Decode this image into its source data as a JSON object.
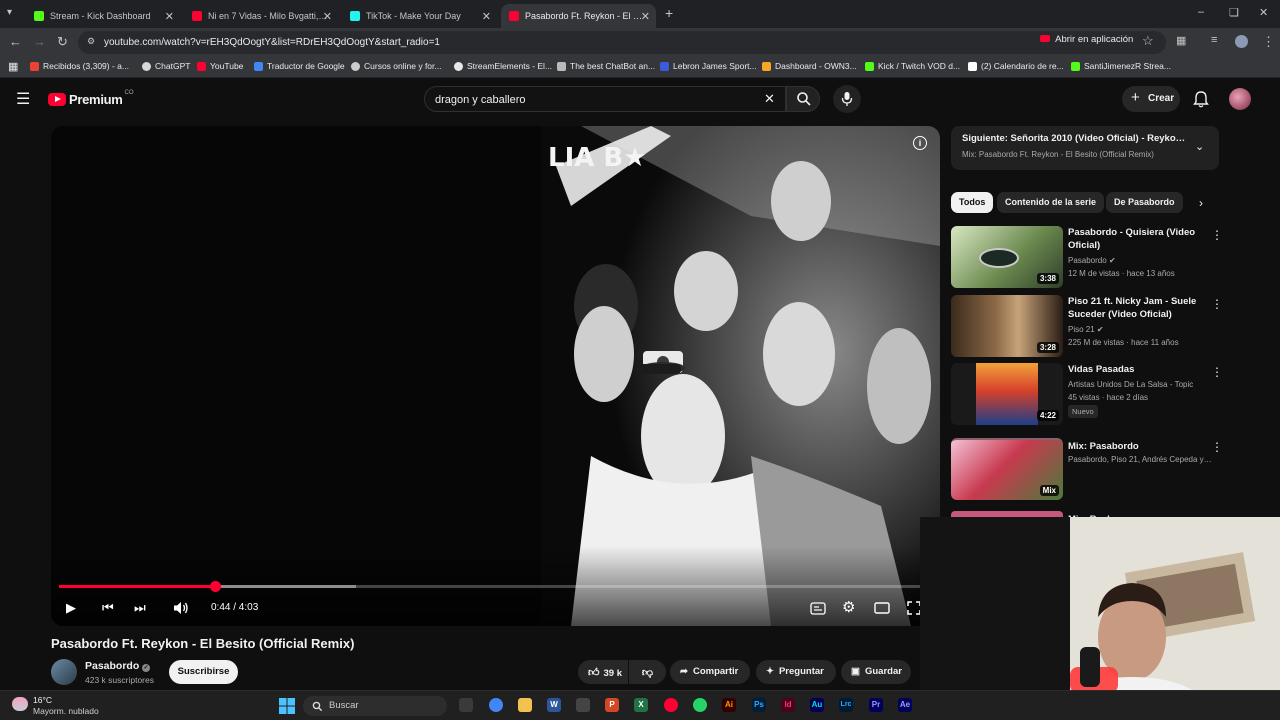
{
  "browser": {
    "tabs": [
      {
        "title": "Stream - Kick Dashboard",
        "color": "#53fc18"
      },
      {
        "title": "Ni en 7 Vidas - Milo Bvgatti, Al",
        "color": "#ff0033"
      },
      {
        "title": "TikTok - Make Your Day",
        "color": "#25f4ee"
      },
      {
        "title": "Pasabordo Ft. Reykon - El Besit",
        "color": "#ff0033"
      }
    ],
    "url": "youtube.com/watch?v=rEH3QdOogtY&list=RDrEH3QdOogtY&start_radio=1",
    "open_in_app": "Abrir en aplicación",
    "bookmarks": [
      {
        "label": "Recibidos (3,309) - a...",
        "color": "#ea4335"
      },
      {
        "label": "ChatGPT",
        "color": "#d9d9d9"
      },
      {
        "label": "YouTube",
        "color": "#ff0033"
      },
      {
        "label": "Traductor de Google",
        "color": "#4285f4"
      },
      {
        "label": "Cursos online y for...",
        "color": "#cccccc"
      },
      {
        "label": "StreamElements - El...",
        "color": "#e8e8e8"
      },
      {
        "label": "The best ChatBot an...",
        "color": "#bbbbbb"
      },
      {
        "label": "Lebron James Sport...",
        "color": "#3b5bdb"
      },
      {
        "label": "Dashboard - OWN3...",
        "color": "#f5a623"
      },
      {
        "label": "Kick / Twitch VOD d...",
        "color": "#53fc18"
      },
      {
        "label": "(2) Calendario de re...",
        "color": "#ffffff"
      },
      {
        "label": "SantiJimenezR Strea...",
        "color": "#53fc18"
      }
    ]
  },
  "youtube": {
    "logo": "Premium",
    "region": "CO",
    "search_value": "dragon y caballero",
    "create_label": "Crear",
    "accent": "#ff0033"
  },
  "player": {
    "time": "0:44 / 4:03",
    "progress_fraction": 0.181,
    "buffer_fraction": 0.344,
    "overlay_text": "LIA B★"
  },
  "video": {
    "title": "Pasabordo Ft. Reykon - El Besito (Official Remix)",
    "channel": "Pasabordo",
    "subscribers": "423 k suscriptores",
    "subscribe_label": "Suscribirse",
    "likes": "39 k",
    "share_label": "Compartir",
    "ask_label": "Preguntar",
    "save_label": "Guardar"
  },
  "sidebar": {
    "upnext_title": "Siguiente: Señorita 2010 (Video Oficial) - Reykon el ...",
    "upnext_sub": "Mix: Pasabordo Ft. Reykon - El Besito (Official Remix)",
    "chips": [
      "Todos",
      "Contenido de la serie",
      "De Pasabordo"
    ],
    "recommendations": [
      {
        "title": "Pasabordo - Quisiera (Video Oficial)",
        "channel": "Pasabordo",
        "meta": "12 M de vistas · hace 13 años",
        "duration": "3:38",
        "verified": true,
        "badge": ""
      },
      {
        "title": "Piso 21 ft. Nicky Jam - Suele Suceder (Video Oficial)",
        "channel": "Piso 21",
        "meta": "225 M de vistas · hace 11 años",
        "duration": "3:28",
        "verified": true,
        "badge": ""
      },
      {
        "title": "Vidas Pasadas",
        "channel": "Artistas Unidos De La Salsa - Topic",
        "meta": "45 vistas · hace 2 días",
        "duration": "4:22",
        "verified": false,
        "badge": "Nuevo"
      },
      {
        "title": "Mix: Pasabordo",
        "channel": "Pasabordo, Piso 21, Andrés Cepeda y m...",
        "meta": "",
        "duration": "Mix",
        "verified": false,
        "badge": ""
      }
    ],
    "partial_title": "Mix: Reykon"
  },
  "taskbar": {
    "temperature": "16°C",
    "weather": "Mayorm. nublado",
    "search_placeholder": "Buscar",
    "apps": [
      {
        "label": "",
        "color": "#3a3a3a"
      },
      {
        "label": "",
        "color": "#4285f4"
      },
      {
        "label": "",
        "color": "#f2c14e"
      },
      {
        "label": "W",
        "color": "#2b579a"
      },
      {
        "label": "",
        "color": "#444444"
      },
      {
        "label": "P",
        "color": "#d24726"
      },
      {
        "label": "X",
        "color": "#217346"
      },
      {
        "label": "",
        "color": "#ff0033"
      },
      {
        "label": "",
        "color": "#25d366"
      },
      {
        "label": "Ai",
        "color": "#330000"
      },
      {
        "label": "Ps",
        "color": "#001e36"
      },
      {
        "label": "Id",
        "color": "#49021f"
      },
      {
        "label": "Au",
        "color": "#00005b"
      },
      {
        "label": "Lrc",
        "color": "#001a33"
      },
      {
        "label": "Pr",
        "color": "#00005b"
      },
      {
        "label": "Ae",
        "color": "#00005b"
      }
    ]
  }
}
